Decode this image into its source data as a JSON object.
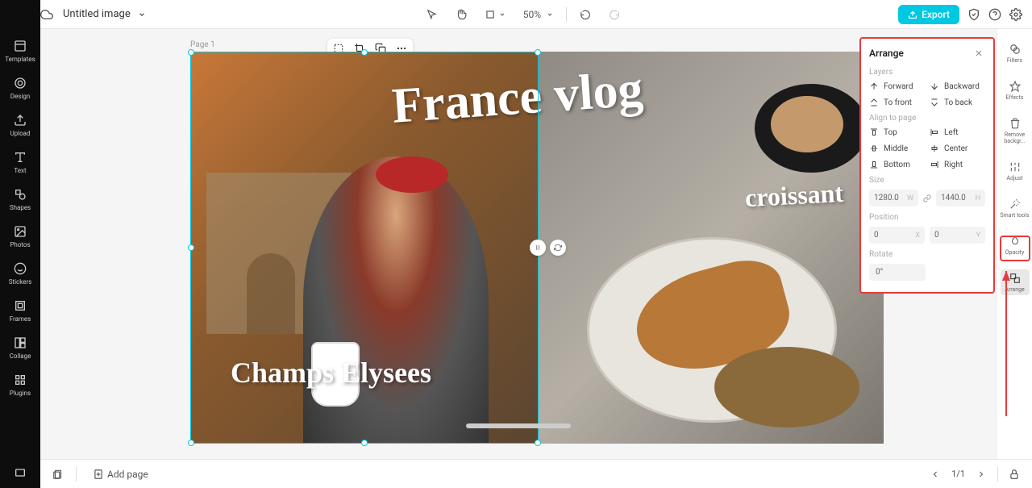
{
  "topbar": {
    "doc_title": "Untitled image",
    "zoom": "50%",
    "export_label": "Export"
  },
  "leftnav": {
    "items": [
      {
        "label": "Templates"
      },
      {
        "label": "Design"
      },
      {
        "label": "Upload"
      },
      {
        "label": "Text"
      },
      {
        "label": "Shapes"
      },
      {
        "label": "Photos"
      },
      {
        "label": "Stickers"
      },
      {
        "label": "Frames"
      },
      {
        "label": "Collage"
      },
      {
        "label": "Plugins"
      }
    ]
  },
  "rightnav": {
    "items": [
      {
        "label": "Filters"
      },
      {
        "label": "Effects"
      },
      {
        "label": "Remove backgr..."
      },
      {
        "label": "Adjust"
      },
      {
        "label": "Smart tools"
      },
      {
        "label": "Opacity"
      },
      {
        "label": "Arrange"
      }
    ]
  },
  "canvas": {
    "page_label": "Page 1",
    "texts": {
      "title": "France vlog",
      "champs": "Champs Elysees",
      "croissant": "croissant"
    }
  },
  "arrange_panel": {
    "title": "Arrange",
    "sections": {
      "layers": "Layers",
      "align": "Align to page",
      "size": "Size",
      "position": "Position",
      "rotate": "Rotate"
    },
    "buttons": {
      "forward": "Forward",
      "backward": "Backward",
      "to_front": "To front",
      "to_back": "To back",
      "top": "Top",
      "left": "Left",
      "middle": "Middle",
      "center": "Center",
      "bottom": "Bottom",
      "right": "Right"
    },
    "size": {
      "w": "1280.0",
      "h": "1440.0",
      "w_unit": "W",
      "h_unit": "H"
    },
    "position": {
      "x": "0",
      "y": "0",
      "x_unit": "X",
      "y_unit": "Y"
    },
    "rotate_value": "0°"
  },
  "bottombar": {
    "add_page": "Add page",
    "page_indicator": "1/1"
  }
}
